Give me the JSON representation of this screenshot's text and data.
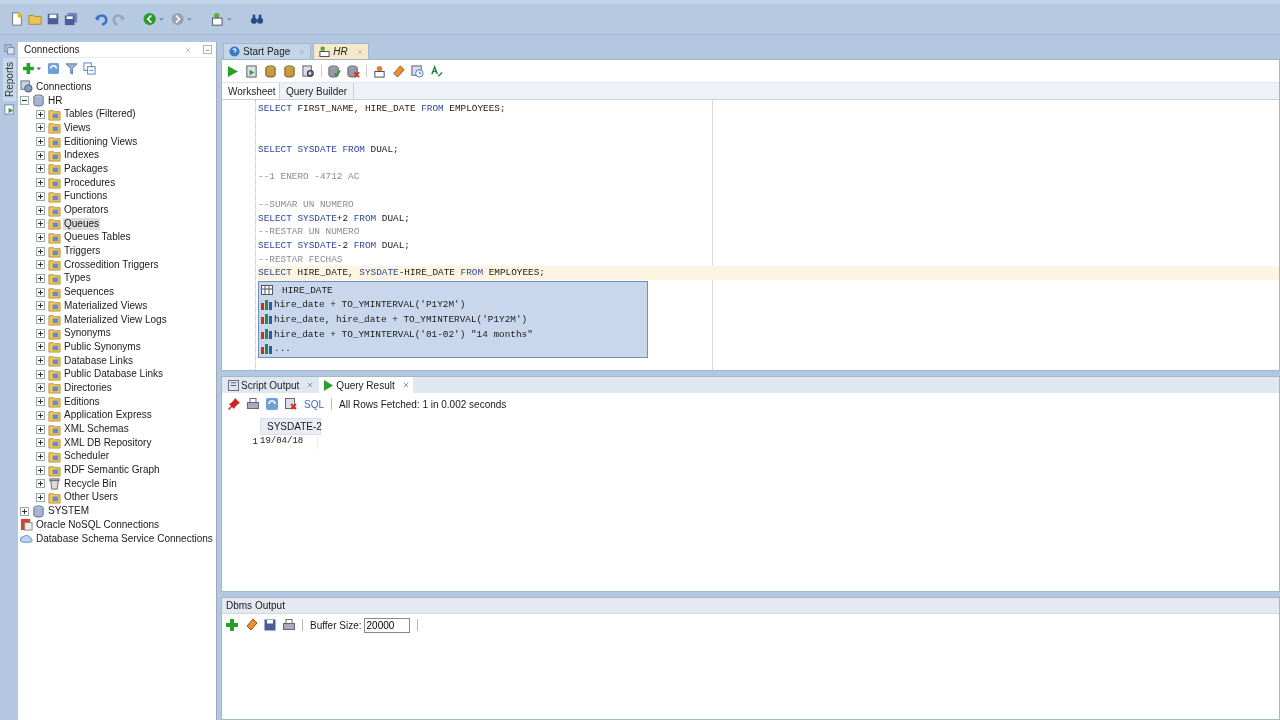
{
  "side_tabs": [
    {
      "label": "Reports",
      "selected": false
    }
  ],
  "connections_panel": {
    "title": "Connections",
    "tree": [
      {
        "label": "Connections",
        "kind": "connections",
        "selected": false,
        "children": [
          {
            "label": "HR",
            "kind": "database",
            "expanded": true,
            "selected": false,
            "children": [
              {
                "label": "Tables (Filtered)",
                "kind": "folder",
                "expanded": false,
                "selected": false
              },
              {
                "label": "Views",
                "kind": "folder",
                "expanded": false,
                "selected": false
              },
              {
                "label": "Editioning Views",
                "kind": "folder",
                "expanded": false,
                "selected": false
              },
              {
                "label": "Indexes",
                "kind": "folder",
                "expanded": false,
                "selected": false
              },
              {
                "label": "Packages",
                "kind": "folder",
                "expanded": false,
                "selected": false
              },
              {
                "label": "Procedures",
                "kind": "folder",
                "expanded": false,
                "selected": false
              },
              {
                "label": "Functions",
                "kind": "folder",
                "expanded": false,
                "selected": false
              },
              {
                "label": "Operators",
                "kind": "folder",
                "expanded": false,
                "selected": false
              },
              {
                "label": "Queues",
                "kind": "folder",
                "expanded": false,
                "selected": true
              },
              {
                "label": "Queues Tables",
                "kind": "folder",
                "expanded": false,
                "selected": false
              },
              {
                "label": "Triggers",
                "kind": "folder",
                "expanded": false,
                "selected": false
              },
              {
                "label": "Crossedition Triggers",
                "kind": "folder",
                "expanded": false,
                "selected": false
              },
              {
                "label": "Types",
                "kind": "folder",
                "expanded": false,
                "selected": false
              },
              {
                "label": "Sequences",
                "kind": "folder",
                "expanded": false,
                "selected": false
              },
              {
                "label": "Materialized Views",
                "kind": "folder",
                "expanded": false,
                "selected": false
              },
              {
                "label": "Materialized View Logs",
                "kind": "folder",
                "expanded": false,
                "selected": false
              },
              {
                "label": "Synonyms",
                "kind": "folder",
                "expanded": false,
                "selected": false
              },
              {
                "label": "Public Synonyms",
                "kind": "folder",
                "expanded": false,
                "selected": false
              },
              {
                "label": "Database Links",
                "kind": "folder",
                "expanded": false,
                "selected": false
              },
              {
                "label": "Public Database Links",
                "kind": "folder",
                "expanded": false,
                "selected": false
              },
              {
                "label": "Directories",
                "kind": "folder",
                "expanded": false,
                "selected": false
              },
              {
                "label": "Editions",
                "kind": "folder",
                "expanded": false,
                "selected": false
              },
              {
                "label": "Application Express",
                "kind": "folder",
                "expanded": false,
                "selected": false
              },
              {
                "label": "XML Schemas",
                "kind": "folder",
                "expanded": false,
                "selected": false
              },
              {
                "label": "XML DB Repository",
                "kind": "folder",
                "expanded": false,
                "selected": false
              },
              {
                "label": "Scheduler",
                "kind": "folder",
                "expanded": false,
                "selected": false
              },
              {
                "label": "RDF Semantic Graph",
                "kind": "folder",
                "expanded": false,
                "selected": false
              },
              {
                "label": "Recycle Bin",
                "kind": "trash",
                "expanded": false,
                "selected": false
              },
              {
                "label": "Other Users",
                "kind": "folder",
                "expanded": false,
                "selected": false
              }
            ]
          },
          {
            "label": "SYSTEM",
            "kind": "database",
            "expanded": false,
            "selected": false
          }
        ]
      },
      {
        "label": "Oracle NoSQL Connections",
        "kind": "nosql",
        "selected": false
      },
      {
        "label": "Database Schema Service Connections",
        "kind": "cloud",
        "selected": false
      }
    ]
  },
  "editor_tabs": [
    {
      "label": "Start Page",
      "kind": "help",
      "selected": false
    },
    {
      "label": "HR",
      "kind": "sql",
      "selected": true
    }
  ],
  "worksheet_tabs": [
    {
      "label": "Worksheet",
      "selected": true
    },
    {
      "label": "Query Builder",
      "selected": false
    }
  ],
  "code_lines": [
    {
      "current": false,
      "tokens": [
        {
          "text": "SELECT",
          "kind": "keyword"
        },
        {
          "text": " FIRST_NAME, HIRE_DATE ",
          "kind": "plain"
        },
        {
          "text": "FROM",
          "kind": "keyword"
        },
        {
          "text": " EMPLOYEES;",
          "kind": "plain"
        }
      ]
    },
    {
      "kind": "blank"
    },
    {
      "kind": "blank"
    },
    {
      "current": false,
      "tokens": [
        {
          "text": "SELECT SYSDATE FROM",
          "kind": "keyword"
        },
        {
          "text": " DUAL;",
          "kind": "plain"
        }
      ]
    },
    {
      "kind": "blank"
    },
    {
      "current": false,
      "tokens": [
        {
          "text": "--1 ENERO -4712 AC",
          "kind": "comment"
        }
      ]
    },
    {
      "kind": "blank"
    },
    {
      "current": false,
      "tokens": [
        {
          "text": "--SUMAR UN NUMERO",
          "kind": "comment"
        }
      ]
    },
    {
      "current": false,
      "tokens": [
        {
          "text": "SELECT SYSDATE",
          "kind": "keyword"
        },
        {
          "text": "+2 ",
          "kind": "plain"
        },
        {
          "text": "FROM",
          "kind": "keyword"
        },
        {
          "text": " DUAL;",
          "kind": "plain"
        }
      ]
    },
    {
      "current": false,
      "tokens": [
        {
          "text": "--RESTAR UN NUMERO",
          "kind": "comment"
        }
      ]
    },
    {
      "current": false,
      "tokens": [
        {
          "text": "SELECT SYSDATE",
          "kind": "keyword"
        },
        {
          "text": "-2 ",
          "kind": "plain"
        },
        {
          "text": "FROM",
          "kind": "keyword"
        },
        {
          "text": " DUAL;",
          "kind": "plain"
        }
      ]
    },
    {
      "current": false,
      "tokens": [
        {
          "text": "--RESTAR FECHAS",
          "kind": "comment"
        }
      ]
    },
    {
      "current": true,
      "tokens": [
        {
          "text": "SELECT",
          "kind": "keyword"
        },
        {
          "text": " HIRE_DATE, ",
          "kind": "plain"
        },
        {
          "text": "SYSDATE",
          "kind": "keyword"
        },
        {
          "text": "-HIRE_DATE ",
          "kind": "plain"
        },
        {
          "text": "FROM",
          "kind": "keyword"
        },
        {
          "text": " EMPLOYEES;",
          "kind": "plain"
        }
      ]
    }
  ],
  "completions": [
    {
      "text": "HIRE_DATE",
      "kind": "column"
    },
    {
      "text": "hire_date + TO_YMINTERVAL('P1Y2M')",
      "kind": "expression"
    },
    {
      "text": "hire_date, hire_date + TO_YMINTERVAL('P1Y2M')",
      "kind": "expression"
    },
    {
      "text": "hire_date + TO_YMINTERVAL('01-02') \"14 months\"",
      "kind": "expression"
    },
    {
      "text": "...",
      "kind": "expression"
    }
  ],
  "output_tabs": [
    {
      "label": "Script Output",
      "kind": "script",
      "selected": false
    },
    {
      "label": "Query Result",
      "kind": "result",
      "selected": true
    }
  ],
  "result": {
    "sql_label": "SQL",
    "status": "All Rows Fetched: 1 in 0.002 seconds",
    "columns": [
      "SYSDATE-2"
    ],
    "rows": [
      {
        "number": "1",
        "cells": [
          "19/04/18"
        ]
      }
    ]
  },
  "dbms_output": {
    "title": "Dbms Output",
    "buffer_label": "Buffer Size:",
    "buffer_value": "20000"
  }
}
